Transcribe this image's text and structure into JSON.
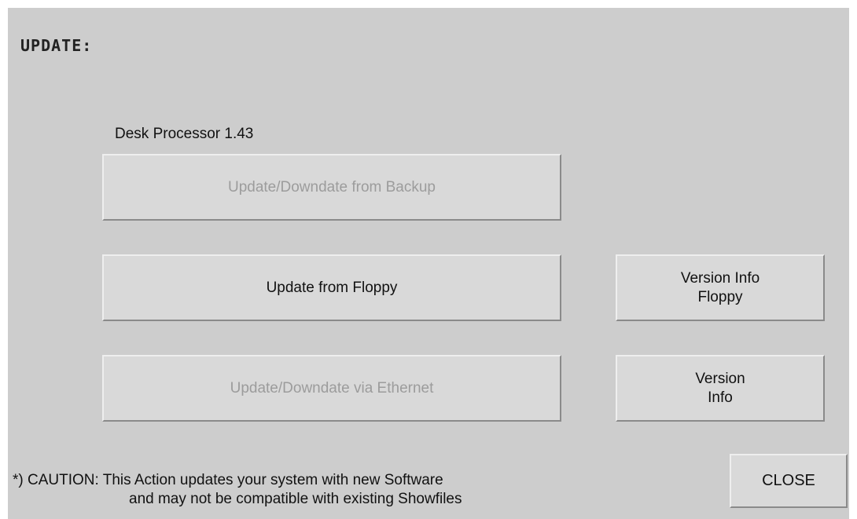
{
  "dialog": {
    "title": "UPDATE:",
    "section_label": "Desk Processor 1.43"
  },
  "buttons": {
    "update_backup": {
      "label": "Update/Downdate from Backup",
      "enabled": false
    },
    "update_floppy": {
      "label": "Update from Floppy",
      "enabled": true
    },
    "update_ethernet": {
      "label": "Update/Downdate via Ethernet",
      "enabled": false
    },
    "version_info_floppy": {
      "line1": "Version Info",
      "line2": "Floppy",
      "enabled": true
    },
    "version_info": {
      "line1": "Version",
      "line2": "Info",
      "enabled": true
    },
    "close": {
      "label": "CLOSE",
      "enabled": true
    }
  },
  "caution": {
    "line1": "*) CAUTION: This Action updates your system with new Software",
    "line2": "and may not be compatible with existing Showfiles"
  },
  "colors": {
    "panel_bg": "#cdcdcd",
    "button_bg": "#d9d9d9",
    "disabled_text": "#9c9c9c"
  }
}
